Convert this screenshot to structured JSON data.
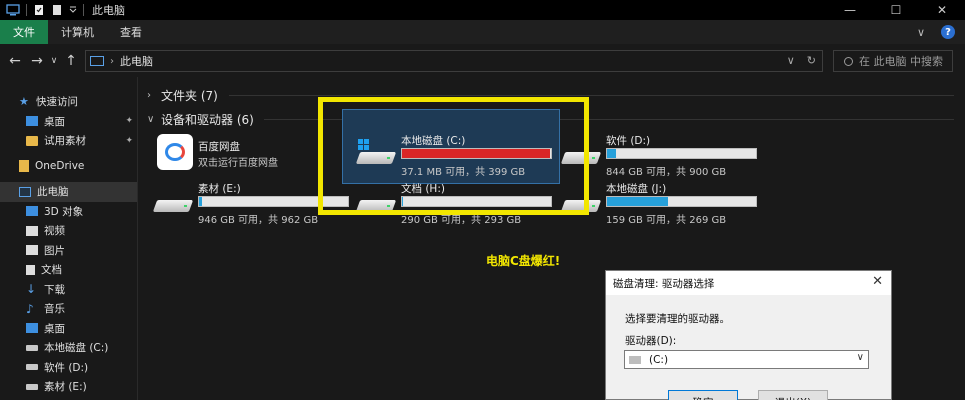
{
  "window": {
    "title": "此电脑",
    "controls": [
      "—",
      "☐",
      "✕"
    ]
  },
  "ribbon": {
    "tabs": [
      {
        "label": "文件",
        "active": true
      },
      {
        "label": "计算机",
        "active": false
      },
      {
        "label": "查看",
        "active": false
      }
    ],
    "expand": "∨",
    "help": "?"
  },
  "nav": {
    "back": "←",
    "forward": "→",
    "recent": "∨",
    "up": "↑",
    "address": "此电脑",
    "address_sep": "›",
    "dropdown": "∨",
    "refresh": "↻",
    "search_placeholder": "在 此电脑 中搜索"
  },
  "sidebar": {
    "items": [
      {
        "label": "快速访问",
        "icon": "star-icon",
        "pinned": false,
        "selected": false
      },
      {
        "label": "桌面",
        "icon": "folder-icon",
        "pinned": true,
        "selected": false
      },
      {
        "label": "试用素材",
        "icon": "folder-icon",
        "pinned": true,
        "selected": false
      },
      {
        "label": "OneDrive",
        "icon": "onedrive-icon",
        "pinned": false,
        "selected": false
      },
      {
        "label": "此电脑",
        "icon": "computer-icon",
        "pinned": false,
        "selected": true
      },
      {
        "label": "3D 对象",
        "icon": "cube-icon",
        "pinned": false,
        "selected": false
      },
      {
        "label": "视频",
        "icon": "video-icon",
        "pinned": false,
        "selected": false
      },
      {
        "label": "图片",
        "icon": "picture-icon",
        "pinned": false,
        "selected": false
      },
      {
        "label": "文档",
        "icon": "document-icon",
        "pinned": false,
        "selected": false
      },
      {
        "label": "下载",
        "icon": "download-icon",
        "pinned": false,
        "selected": false
      },
      {
        "label": "音乐",
        "icon": "music-icon",
        "pinned": false,
        "selected": false
      },
      {
        "label": "桌面",
        "icon": "desktop-icon",
        "pinned": false,
        "selected": false
      },
      {
        "label": "本地磁盘 (C:)",
        "icon": "drive-icon",
        "pinned": false,
        "selected": false
      },
      {
        "label": "软件 (D:)",
        "icon": "drive-icon",
        "pinned": false,
        "selected": false
      },
      {
        "label": "素材 (E:)",
        "icon": "drive-icon",
        "pinned": false,
        "selected": false
      }
    ],
    "pin_glyph": "📌"
  },
  "content": {
    "folders_header": "文件夹 (7)",
    "drives_header": "设备和驱动器 (6)",
    "baidu": {
      "name": "百度网盘",
      "sub": "双击运行百度网盘"
    },
    "drives": [
      {
        "name": "本地磁盘 (C:)",
        "sub": "37.1 MB 可用，共 399 GB",
        "used_fraction": 0.99,
        "critical": true
      },
      {
        "name": "软件 (D:)",
        "sub": "844 GB 可用，共 900 GB",
        "used_fraction": 0.06,
        "critical": false
      },
      {
        "name": "素材 (E:)",
        "sub": "946 GB 可用，共 962 GB",
        "used_fraction": 0.02,
        "critical": false
      },
      {
        "name": "文档 (H:)",
        "sub": "290 GB 可用，共 293 GB",
        "used_fraction": 0.01,
        "critical": false
      },
      {
        "name": "本地磁盘 (J:)",
        "sub": "159 GB 可用，共 269 GB",
        "used_fraction": 0.41,
        "critical": false
      }
    ],
    "caption": "电脑C盘爆红!"
  },
  "dialog": {
    "title": "磁盘清理: 驱动器选择",
    "close": "✕",
    "prompt": "选择要清理的驱动器。",
    "drive_label": "驱动器(D):",
    "selected_drive": "(C:)",
    "ok": "确定",
    "cancel": "退出(X)"
  },
  "colors": {
    "accent_green": "#1a7f4b",
    "bar_blue": "#26a0da",
    "bar_red": "#da2626",
    "highlight_yellow": "#f2e600"
  }
}
